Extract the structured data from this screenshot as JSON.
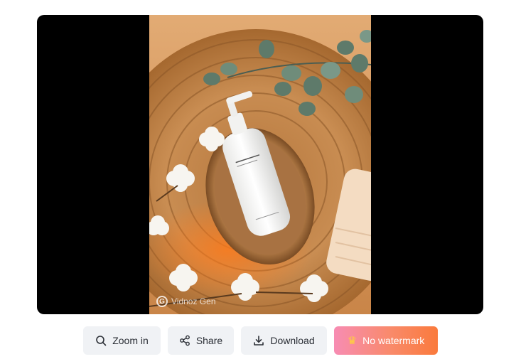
{
  "preview": {
    "watermark_logo": "G",
    "watermark_text": "Vidnoz Gen",
    "image_alt": "Photo of a white pump bottle in a cork bowl on a woven seagrass mat with cotton flowers, eucalyptus and a towel",
    "background_color": "#000000"
  },
  "actions": {
    "zoom_label": "Zoom in",
    "zoom_icon": "magnifier-icon",
    "share_label": "Share",
    "share_icon": "share-nodes-icon",
    "download_label": "Download",
    "download_icon": "download-arrow-icon",
    "no_watermark_label": "No watermark",
    "no_watermark_icon": "crown-icon",
    "no_watermark_gradient": [
      "#f78cb3",
      "#fa7a3c"
    ]
  }
}
